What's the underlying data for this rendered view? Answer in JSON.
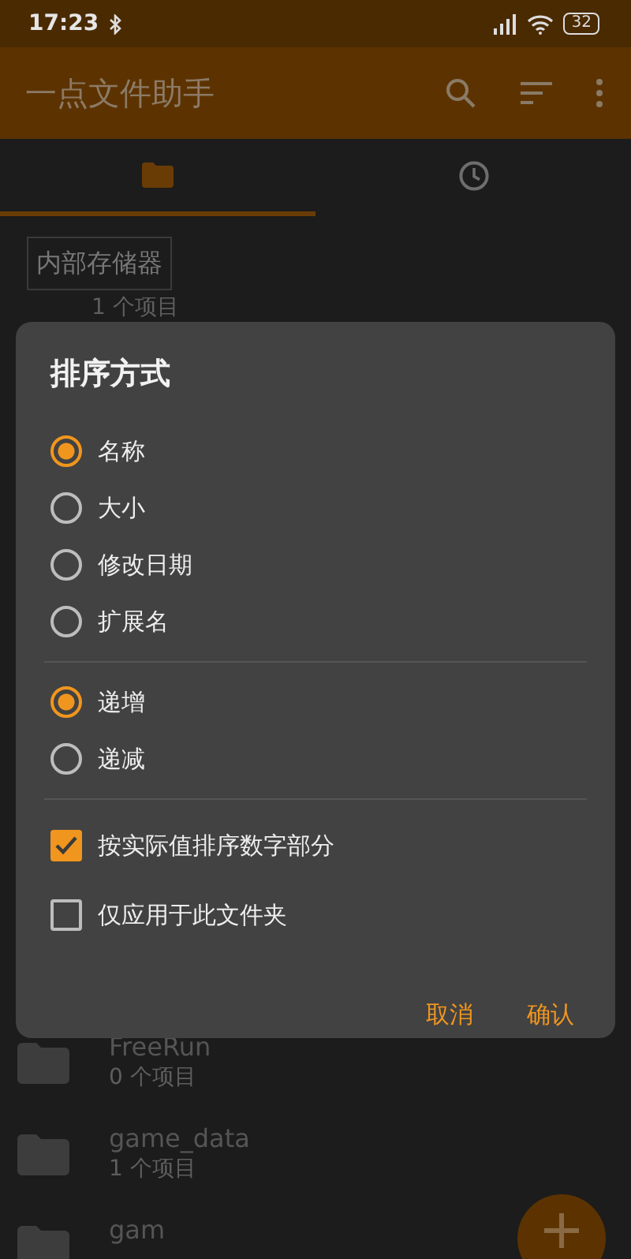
{
  "status_bar": {
    "time": "17:23",
    "battery": "32"
  },
  "app_bar": {
    "title": "一点文件助手"
  },
  "tabs": [
    {
      "kind": "folder",
      "selected": true
    },
    {
      "kind": "clock",
      "selected": false
    }
  ],
  "breadcrumb": "内部存储器",
  "files": [
    {
      "subtitle": "1 个项目"
    },
    {
      "name": "FreeRun",
      "subtitle": "0 个项目"
    },
    {
      "name": "game_data",
      "subtitle": "1 个项目"
    },
    {
      "name": "gam"
    }
  ],
  "dialog": {
    "title": "排序方式",
    "sort_by": [
      {
        "label": "名称",
        "selected": true
      },
      {
        "label": "大小",
        "selected": false
      },
      {
        "label": "修改日期",
        "selected": false
      },
      {
        "label": "扩展名",
        "selected": false
      }
    ],
    "order": [
      {
        "label": "递增",
        "selected": true
      },
      {
        "label": "递减",
        "selected": false
      }
    ],
    "options": [
      {
        "label": "按实际值排序数字部分",
        "checked": true
      },
      {
        "label": "仅应用于此文件夹",
        "checked": false
      }
    ],
    "buttons": [
      "取消",
      "确认"
    ]
  }
}
